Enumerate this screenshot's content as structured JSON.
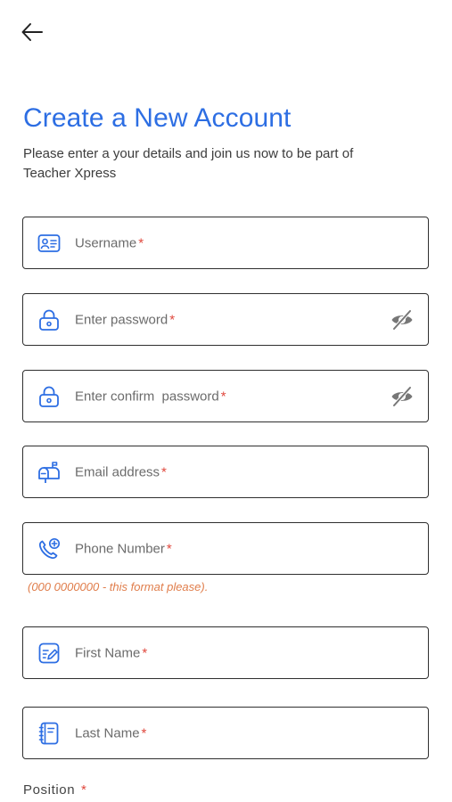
{
  "header": {
    "title": "Create a New Account",
    "subtitle": "Please enter a your details and join us now to be part of Teacher Xpress"
  },
  "form": {
    "required_mark": "*",
    "username": {
      "placeholder": "Username",
      "icon": "id-card-icon"
    },
    "password": {
      "placeholder": "Enter password",
      "icon": "lock-icon",
      "toggle_icon": "eye-off-icon"
    },
    "confirm_password": {
      "placeholder": "Enter confirm  password",
      "icon": "lock-icon",
      "toggle_icon": "eye-off-icon"
    },
    "email": {
      "placeholder": "Email address",
      "icon": "mailbox-icon"
    },
    "phone": {
      "placeholder": "Phone Number",
      "icon": "phone-plus-icon",
      "hint": "(000 0000000 - this format please)."
    },
    "first_name": {
      "placeholder": "First Name",
      "icon": "edit-note-icon"
    },
    "last_name": {
      "placeholder": "Last Name",
      "icon": "notebook-icon"
    },
    "position": {
      "label": "Position"
    }
  },
  "colors": {
    "accent": "#2d6ee3",
    "required": "#e0473c",
    "hint": "#e07d4b",
    "border": "#2f2f2f"
  }
}
